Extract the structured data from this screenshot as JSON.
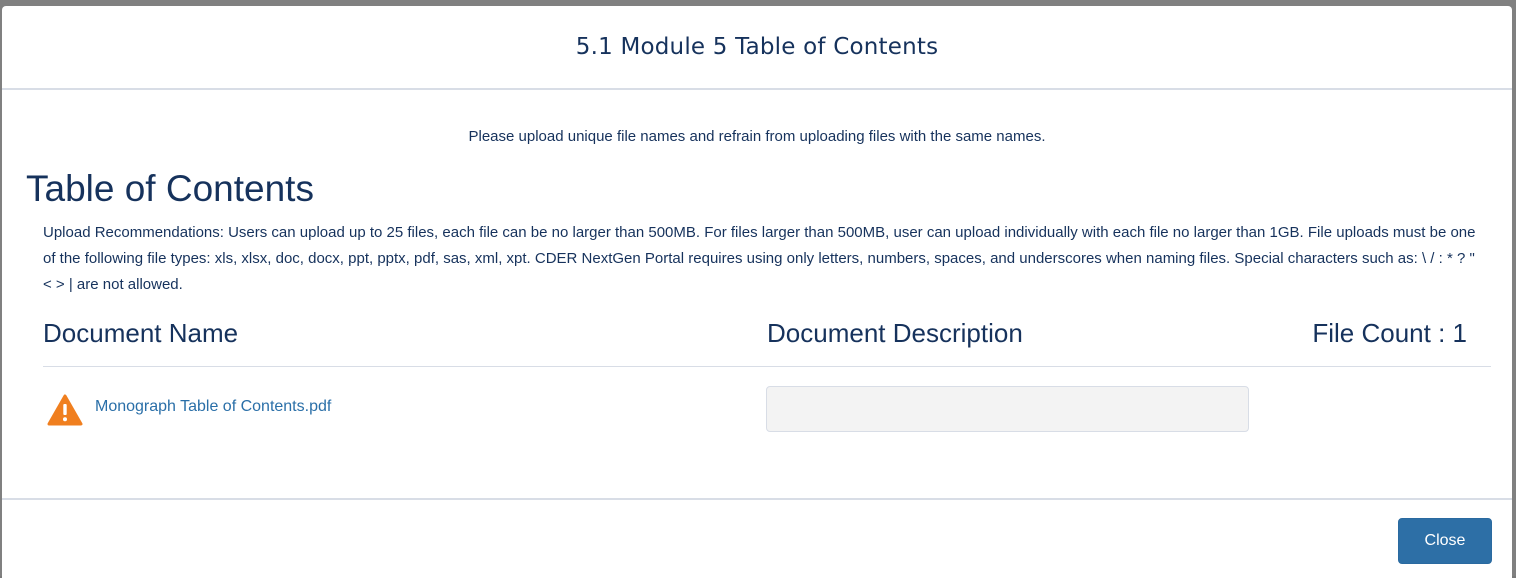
{
  "modal": {
    "title": "5.1 Module 5 Table of Contents"
  },
  "body": {
    "notice": "Please upload unique file names and refrain from uploading files with the same names.",
    "heading": "Table of Contents",
    "recommendations": "Upload Recommendations: Users can upload up to 25 files, each file can be no larger than 500MB. For files larger than 500MB, user can upload individually with each file no larger than 1GB. File uploads must be one of the following file types: xls, xlsx, doc, docx, ppt, pptx, pdf, sas, xml, xpt. CDER NextGen Portal requires using only letters, numbers, spaces, and underscores when naming files. Special characters such as: \\ / : * ? \" < > | are not allowed."
  },
  "table": {
    "columns": {
      "name": "Document Name",
      "description": "Document Description",
      "file_count": "File Count : 1"
    },
    "rows": [
      {
        "file_name": "Monograph Table of Contents.pdf",
        "status_icon": "warning-icon",
        "description_value": ""
      }
    ]
  },
  "footer": {
    "close_label": "Close"
  },
  "colors": {
    "text": "#16325c",
    "link": "#2a6fa8",
    "warning": "#f07f1f",
    "button": "#2d6fa6",
    "divider": "#d8dde6"
  }
}
